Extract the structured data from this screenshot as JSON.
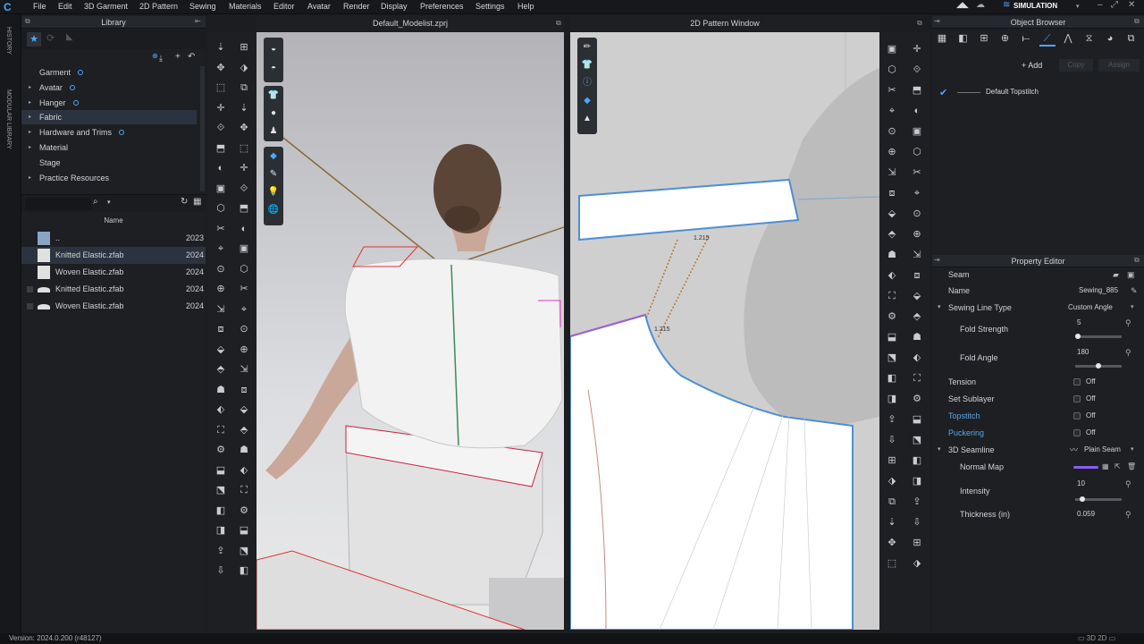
{
  "app": {
    "brand_color": "#4aa8ff",
    "menu": [
      "File",
      "Edit",
      "3D Garment",
      "2D Pattern",
      "Sewing",
      "Materials",
      "Editor",
      "Avatar",
      "Render",
      "Display",
      "Preferences",
      "Settings",
      "Help"
    ],
    "mode": "SIMULATION"
  },
  "side_strip": {
    "history": "HISTORY",
    "modular": "MODULAR LIBRARY"
  },
  "library": {
    "title": "Library",
    "tree": [
      {
        "label": "Garment",
        "arrow": "",
        "dot": true
      },
      {
        "label": "Avatar",
        "arrow": "▸",
        "dot": true
      },
      {
        "label": "Hanger",
        "arrow": "▸",
        "dot": true
      },
      {
        "label": "Fabric",
        "arrow": "▸",
        "dot": false,
        "selected": true
      },
      {
        "label": "Hardware and Trims",
        "arrow": "▸",
        "dot": true
      },
      {
        "label": "Material",
        "arrow": "▸",
        "dot": false
      },
      {
        "label": "Stage",
        "arrow": "",
        "dot": false
      },
      {
        "label": "Practice Resources",
        "arrow": "▸",
        "dot": false
      }
    ],
    "column_header": "Name",
    "files": [
      {
        "name": "..",
        "year": "2023"
      },
      {
        "name": "Knitted Elastic.zfab",
        "year": "2024",
        "selected": true
      },
      {
        "name": "Woven Elastic.zfab",
        "year": "2024"
      },
      {
        "name": "Knitted Elastic.zfab",
        "year": "2024"
      },
      {
        "name": "Woven Elastic.zfab",
        "year": "2024"
      }
    ]
  },
  "viewport3d": {
    "title": "Default_Modelist.zprj"
  },
  "viewport2d": {
    "title": "2D Pattern Window",
    "measure_a": "1.215",
    "measure_b": "1.215"
  },
  "object_browser": {
    "title": "Object Browser",
    "add_label": "+ Add",
    "copy_label": "Copy",
    "assign_label": "Assign",
    "items": [
      {
        "label": "Default Topstitch"
      }
    ]
  },
  "property_editor": {
    "title": "Property Editor",
    "section": "Seam",
    "rows": {
      "name_label": "Name",
      "name_value": "Sewing_885",
      "sewing_line_type_label": "Sewing Line Type",
      "sewing_line_type_value": "Custom Angle",
      "fold_strength_label": "Fold Strength",
      "fold_strength_value": "5",
      "fold_strength_level": 0.0,
      "fold_angle_label": "Fold Angle",
      "fold_angle_value": "180",
      "fold_angle_level": 0.5,
      "tension_label": "Tension",
      "tension_value": "Off",
      "set_sublayer_label": "Set Sublayer",
      "set_sublayer_value": "Off",
      "topstitch_label": "Topstitch",
      "topstitch_value": "Off",
      "puckering_label": "Puckering",
      "puckering_value": "Off",
      "seamline_label": "3D Seamline",
      "seamline_value": "Plain Seam",
      "normal_map_label": "Normal Map",
      "intensity_label": "Intensity",
      "intensity_value": "10",
      "intensity_level": 0.1,
      "thickness_label": "Thickness (in)",
      "thickness_value": "0.059"
    },
    "highlight_color": "#5aa7e6",
    "normal_map_color": "#8a5cf6"
  },
  "status": {
    "version": "Version: 2024.0.200 (r48127)"
  }
}
